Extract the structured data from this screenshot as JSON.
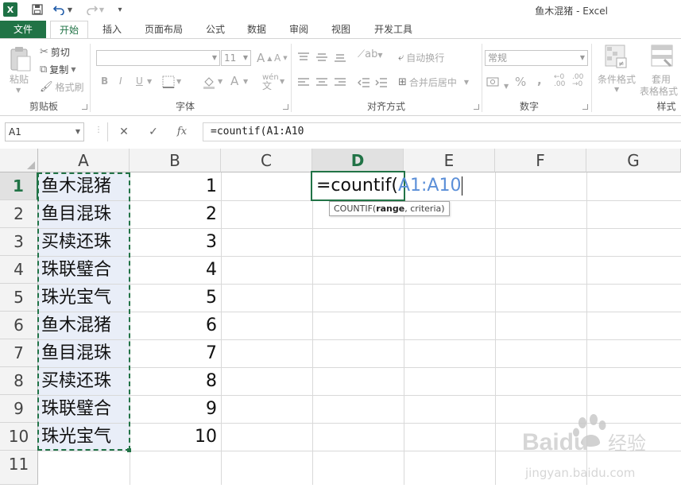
{
  "window": {
    "title": "鱼木混猪 - Excel"
  },
  "tabs": [
    {
      "label": "文件"
    },
    {
      "label": "开始"
    },
    {
      "label": "插入"
    },
    {
      "label": "页面布局"
    },
    {
      "label": "公式"
    },
    {
      "label": "数据"
    },
    {
      "label": "审阅"
    },
    {
      "label": "视图"
    },
    {
      "label": "开发工具"
    }
  ],
  "ribbon": {
    "clipboard": {
      "paste": "粘贴",
      "cut": "剪切",
      "copy": "复制",
      "format_painter": "格式刷",
      "label": "剪贴板"
    },
    "font": {
      "size": "11",
      "label": "字体",
      "bold": "B",
      "italic": "I",
      "underline": "U",
      "grow": "A",
      "shrink": "A",
      "color": "A"
    },
    "alignment": {
      "wrap": "自动换行",
      "merge": "合并后居中",
      "label": "对齐方式"
    },
    "number": {
      "format": "常规",
      "percent": "%",
      "comma": ",",
      "label": "数字"
    },
    "styles": {
      "conditional": "条件格式",
      "table_format_1": "套用",
      "table_format_2": "表格格式",
      "label": "样式"
    }
  },
  "formula_bar": {
    "name_box": "A1",
    "cancel": "✕",
    "enter": "✓",
    "fx": "fx",
    "content": "=countif(A1:A10"
  },
  "grid": {
    "columns": [
      "A",
      "B",
      "C",
      "D",
      "E",
      "F",
      "G"
    ],
    "active_column": "D",
    "rows": [
      "1",
      "2",
      "3",
      "4",
      "5",
      "6",
      "7",
      "8",
      "9",
      "10",
      "11"
    ],
    "active_row": "1",
    "colA": [
      "鱼木混猪",
      "鱼目混珠",
      "买椟还珠",
      "珠联璧合",
      "珠光宝气",
      "鱼木混猪",
      "鱼目混珠",
      "买椟还珠",
      "珠联璧合",
      "珠光宝气"
    ],
    "colB": [
      "1",
      "2",
      "3",
      "4",
      "5",
      "6",
      "7",
      "8",
      "9",
      "10"
    ],
    "edit_cell": {
      "prefix": "=countif(",
      "ref": "A1:A10"
    },
    "tooltip": {
      "func": "COUNTIF(",
      "arg1": "range",
      "rest": ", criteria)"
    }
  },
  "watermark": {
    "brand": "Baidu",
    "brand_cn": "经验",
    "url": "jingyan.baidu.com"
  },
  "colors": {
    "accent": "#217346",
    "ref_blue": "#5b8fd8",
    "selection_fill": "#e9eef8"
  }
}
